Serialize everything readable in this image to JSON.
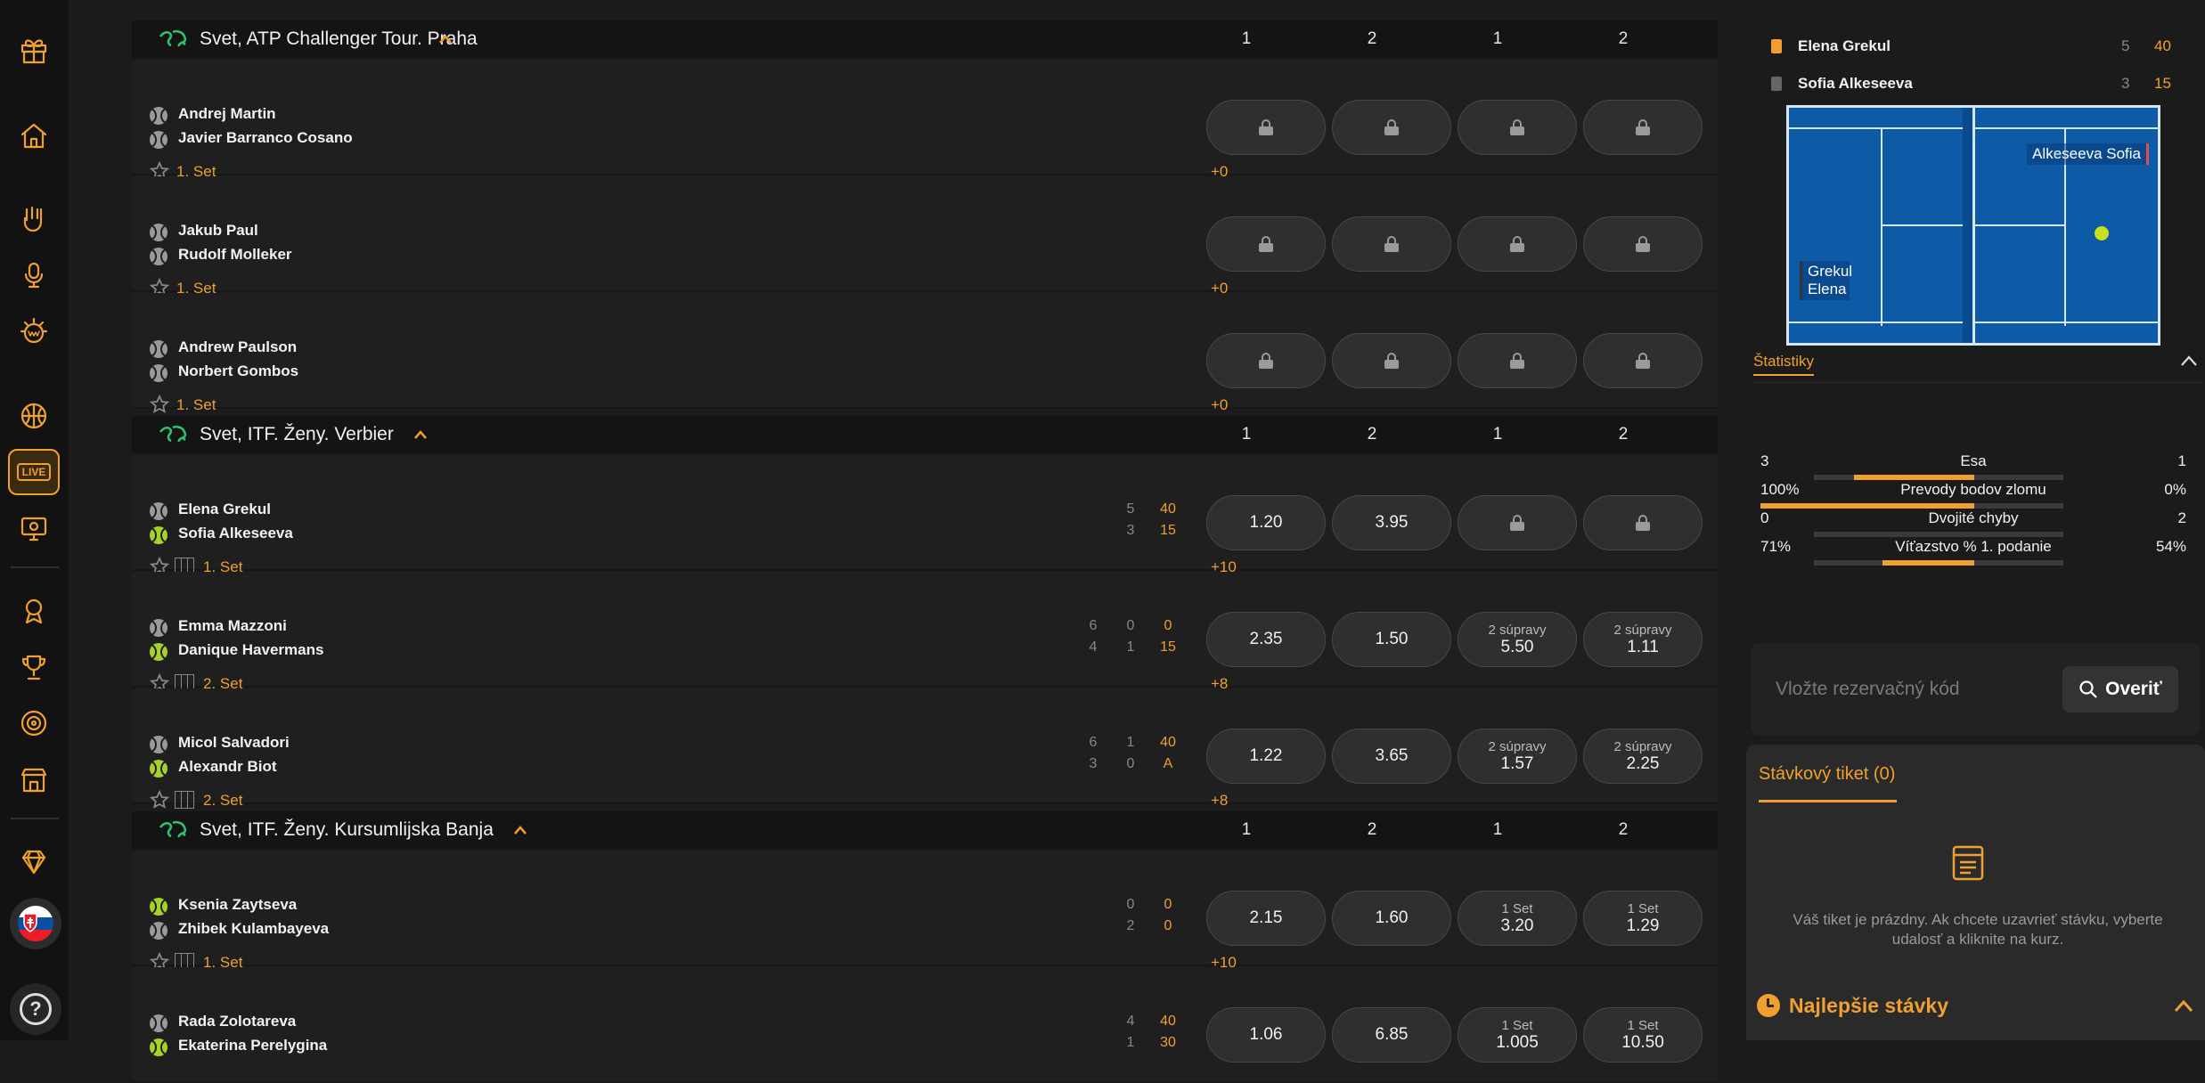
{
  "sidebar": {
    "icons": [
      "gift-icon",
      "home-icon",
      "rock-hand-icon",
      "microphone-icon",
      "win-badge-icon",
      "basketball-icon",
      "live-icon",
      "tv-sport-icon",
      "award-icon",
      "trophy-icon",
      "target-icon",
      "store-icon",
      "diamond-icon"
    ],
    "live_label": "LIVE",
    "help_label": "?"
  },
  "sections": [
    {
      "title": "Svet, ATP Challenger Tour. Praha",
      "cols": [
        "1",
        "2",
        "1",
        "2"
      ],
      "events": [
        {
          "p1": "Andrej Martin",
          "p2": "Javier Barranco Cosano",
          "p1_ball": "grey",
          "p2_ball": "grey",
          "set": "1. Set",
          "court": false,
          "scores": [],
          "more": "+0",
          "odds": [
            {
              "lock": true
            },
            {
              "lock": true
            },
            {
              "lock": true
            },
            {
              "lock": true
            }
          ]
        },
        {
          "p1": "Jakub Paul",
          "p2": "Rudolf Molleker",
          "p1_ball": "grey",
          "p2_ball": "grey",
          "set": "1. Set",
          "court": false,
          "scores": [],
          "more": "+0",
          "odds": [
            {
              "lock": true
            },
            {
              "lock": true
            },
            {
              "lock": true
            },
            {
              "lock": true
            }
          ]
        },
        {
          "p1": "Andrew Paulson",
          "p2": "Norbert Gombos",
          "p1_ball": "grey",
          "p2_ball": "grey",
          "set": "1. Set",
          "court": false,
          "scores": [],
          "more": "+0",
          "odds": [
            {
              "lock": true
            },
            {
              "lock": true
            },
            {
              "lock": true
            },
            {
              "lock": true
            }
          ]
        }
      ]
    },
    {
      "title": "Svet, ITF. Ženy. Verbier",
      "cols": [
        "1",
        "2",
        "1",
        "2"
      ],
      "events": [
        {
          "p1": "Elena Grekul",
          "p2": "Sofia Alkeseeva",
          "p1_ball": "grey",
          "p2_ball": "green",
          "set": "1. Set",
          "court": true,
          "scores": [
            [
              "5",
              "40"
            ],
            [
              "3",
              "15"
            ]
          ],
          "more": "+10",
          "odds": [
            {
              "val": "1.20"
            },
            {
              "val": "3.95"
            },
            {
              "lock": true
            },
            {
              "lock": true
            }
          ]
        },
        {
          "p1": "Emma Mazzoni",
          "p2": "Danique Havermans",
          "p1_ball": "grey",
          "p2_ball": "green",
          "set": "2. Set",
          "court": true,
          "scores": [
            [
              "6",
              "0",
              "0"
            ],
            [
              "4",
              "1",
              "15"
            ]
          ],
          "more": "+8",
          "odds": [
            {
              "val": "2.35"
            },
            {
              "val": "1.50"
            },
            {
              "lab": "2 súpravy",
              "val": "5.50"
            },
            {
              "lab": "2 súpravy",
              "val": "1.11"
            }
          ]
        },
        {
          "p1": "Micol Salvadori",
          "p2": "Alexandr Biot",
          "p1_ball": "grey",
          "p2_ball": "green",
          "set": "2. Set",
          "court": true,
          "scores": [
            [
              "6",
              "1",
              "40"
            ],
            [
              "3",
              "0",
              "A"
            ]
          ],
          "more": "+8",
          "odds": [
            {
              "val": "1.22"
            },
            {
              "val": "3.65"
            },
            {
              "lab": "2 súpravy",
              "val": "1.57"
            },
            {
              "lab": "2 súpravy",
              "val": "2.25"
            }
          ]
        }
      ]
    },
    {
      "title": "Svet, ITF. Ženy. Kursumlijska Banja",
      "cols": [
        "1",
        "2",
        "1",
        "2"
      ],
      "events": [
        {
          "p1": "Ksenia Zaytseva",
          "p2": "Zhibek Kulambayeva",
          "p1_ball": "green",
          "p2_ball": "grey",
          "set": "1. Set",
          "court": true,
          "scores": [
            [
              "0",
              "0"
            ],
            [
              "2",
              "0"
            ]
          ],
          "more": "+10",
          "odds": [
            {
              "val": "2.15"
            },
            {
              "val": "1.60"
            },
            {
              "lab": "1 Set",
              "val": "3.20"
            },
            {
              "lab": "1 Set",
              "val": "1.29"
            }
          ]
        },
        {
          "p1": "Rada Zolotareva",
          "p2": "Ekaterina Perelygina",
          "p1_ball": "grey",
          "p2_ball": "green",
          "set": "",
          "court": false,
          "scores": [
            [
              "4",
              "40"
            ],
            [
              "1",
              "30"
            ]
          ],
          "more": "",
          "odds": [
            {
              "val": "1.06"
            },
            {
              "val": "6.85"
            },
            {
              "lab": "1 Set",
              "val": "1.005"
            },
            {
              "lab": "1 Set",
              "val": "10.50"
            }
          ]
        }
      ]
    }
  ],
  "right": {
    "score_rows": [
      {
        "name": "Elena Grekul",
        "games": "5",
        "points": "40"
      },
      {
        "name": "Sofia Alkeseeva",
        "games": "3",
        "points": "15"
      }
    ],
    "court_top_label": "Alkeseeva Sofia",
    "court_bottom_label": "Grekul Elena",
    "stats_title": "Štatistiky",
    "stats": [
      {
        "a": "3",
        "label": "Esa",
        "b": "1",
        "left_pct": 75,
        "right_pct": 0
      },
      {
        "a": "100%",
        "label": "Prevody bodov zlomu",
        "b": "0%",
        "left_pct": 100,
        "right_pct": 0
      },
      {
        "a": "0",
        "label": "Dvojité chyby",
        "b": "2",
        "left_pct": 0,
        "right_pct": 0
      },
      {
        "a": "71%",
        "label": "Víťazstvo % 1. podanie",
        "b": "54%",
        "left_pct": 57,
        "right_pct": 0
      }
    ],
    "code_placeholder": "Vložte rezervačný kód",
    "verify_label": "Overiť",
    "ticket_title": "Stávkový tiket (0)",
    "ticket_empty": "Váš tiket je prázdny. Ak chcete uzavrieť stávku, vyberte udalosť a kliknite na kurz.",
    "best_title": "Najlepšie stávky"
  },
  "colors": {
    "accent": "#f0a030",
    "bg": "#1b1b1b",
    "live_ball": "#a8d12a",
    "court": "#0d5aa7"
  }
}
